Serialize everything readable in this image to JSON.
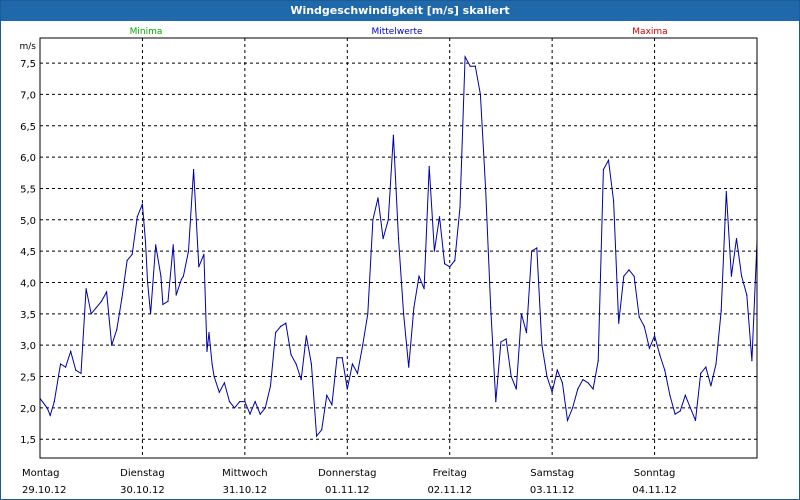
{
  "window": {
    "title": "Windgeschwindigkeit [m/s] skaliert"
  },
  "colors": {
    "background": "#ffffff",
    "titlebar": "#1f68a9",
    "minima": "#00aa00",
    "mittelwerte": "#0000cc",
    "maxima": "#cc0000",
    "line": "#0000aa",
    "grid": "#000000"
  },
  "chart_data": {
    "type": "line",
    "title": "Windgeschwindigkeit [m/s] skaliert",
    "ylabel": "m/s",
    "legend": [
      "Minima",
      "Mittelwerte",
      "Maxima"
    ],
    "legend_position": "top",
    "grid": true,
    "ylim": [
      1.2,
      7.9
    ],
    "yticks": [
      "1,5",
      "2,0",
      "2,5",
      "3,0",
      "3,5",
      "4,0",
      "4,5",
      "5,0",
      "5,5",
      "6,0",
      "6,5",
      "7,0",
      "7,5"
    ],
    "ytick_values": [
      1.5,
      2.0,
      2.5,
      3.0,
      3.5,
      4.0,
      4.5,
      5.0,
      5.5,
      6.0,
      6.5,
      7.0,
      7.5
    ],
    "xlim": [
      0,
      7
    ],
    "xticks": [
      {
        "day": "Montag",
        "date": "29.10.12"
      },
      {
        "day": "Dienstag",
        "date": "30.10.12"
      },
      {
        "day": "Mittwoch",
        "date": "31.10.12"
      },
      {
        "day": "Donnerstag",
        "date": "01.11.12"
      },
      {
        "day": "Freitag",
        "date": "02.11.12"
      },
      {
        "day": "Samstag",
        "date": "03.11.12"
      },
      {
        "day": "Sonntag",
        "date": "04.11.12"
      }
    ],
    "series": [
      {
        "name": "Mittelwerte",
        "x": [
          0,
          0.07,
          0.1,
          0.14,
          0.2,
          0.25,
          0.3,
          0.35,
          0.4,
          0.45,
          0.5,
          0.55,
          0.6,
          0.65,
          0.7,
          0.75,
          0.8,
          0.85,
          0.9,
          0.95,
          1.0,
          1.03,
          1.05,
          1.08,
          1.13,
          1.18,
          1.2,
          1.25,
          1.3,
          1.33,
          1.38,
          1.4,
          1.45,
          1.5,
          1.55,
          1.6,
          1.63,
          1.65,
          1.68,
          1.7,
          1.75,
          1.8,
          1.85,
          1.9,
          1.95,
          2.0,
          2.05,
          2.1,
          2.15,
          2.2,
          2.25,
          2.3,
          2.35,
          2.4,
          2.45,
          2.5,
          2.55,
          2.6,
          2.65,
          2.7,
          2.75,
          2.8,
          2.85,
          2.9,
          2.95,
          3.0,
          3.05,
          3.1,
          3.15,
          3.2,
          3.25,
          3.3,
          3.35,
          3.4,
          3.45,
          3.5,
          3.55,
          3.6,
          3.65,
          3.7,
          3.75,
          3.8,
          3.85,
          3.9,
          3.95,
          4.0,
          4.05,
          4.1,
          4.15,
          4.2,
          4.25,
          4.3,
          4.35,
          4.4,
          4.45,
          4.5,
          4.55,
          4.6,
          4.65,
          4.7,
          4.75,
          4.8,
          4.85,
          4.9,
          4.95,
          5.0,
          5.05,
          5.1,
          5.15,
          5.2,
          5.25,
          5.3,
          5.35,
          5.4,
          5.45,
          5.5,
          5.55,
          5.6,
          5.65,
          5.7,
          5.75,
          5.8,
          5.85,
          5.9,
          5.95,
          6.0,
          6.05,
          6.1,
          6.15,
          6.2,
          6.25,
          6.3,
          6.35,
          6.4,
          6.45,
          6.5,
          6.55,
          6.6,
          6.65,
          6.7,
          6.75,
          6.8,
          6.85,
          6.9,
          6.95,
          7.0
        ],
        "values": [
          2.15,
          2.0,
          1.88,
          2.1,
          2.7,
          2.65,
          2.9,
          2.6,
          2.55,
          3.9,
          3.5,
          3.6,
          3.7,
          3.85,
          3.0,
          3.25,
          3.75,
          4.35,
          4.45,
          5.05,
          5.25,
          4.65,
          4.0,
          3.5,
          4.6,
          4.1,
          3.65,
          3.7,
          4.6,
          3.8,
          4.05,
          4.1,
          4.5,
          5.8,
          4.25,
          4.45,
          2.9,
          3.2,
          2.7,
          2.5,
          2.25,
          2.4,
          2.1,
          2.0,
          2.1,
          2.1,
          1.9,
          2.1,
          1.9,
          2.0,
          2.35,
          3.2,
          3.3,
          3.35,
          2.85,
          2.7,
          2.45,
          3.15,
          2.7,
          1.55,
          1.65,
          2.2,
          2.05,
          2.8,
          2.8,
          2.3,
          2.7,
          2.55,
          3.0,
          3.5,
          5.0,
          5.35,
          4.7,
          5.0,
          6.35,
          4.7,
          3.5,
          2.65,
          3.6,
          4.1,
          3.9,
          5.85,
          4.5,
          5.05,
          4.3,
          4.25,
          4.35,
          5.2,
          7.6,
          7.45,
          7.45,
          7.0,
          5.5,
          3.6,
          2.1,
          3.05,
          3.1,
          2.5,
          2.3,
          3.5,
          3.2,
          4.5,
          4.55,
          3.0,
          2.5,
          2.25,
          2.6,
          2.4,
          1.8,
          2.0,
          2.3,
          2.45,
          2.4,
          2.3,
          2.75,
          5.8,
          5.95,
          5.3,
          3.35,
          4.1,
          4.2,
          4.1,
          3.45,
          3.3,
          2.95,
          3.15,
          2.85,
          2.6,
          2.2,
          1.9,
          1.95,
          2.2,
          2.0,
          1.8,
          2.55,
          2.65,
          2.35,
          2.7,
          3.55,
          5.45,
          4.1,
          4.7,
          4.1,
          3.8,
          2.75,
          4.65
        ]
      }
    ]
  }
}
